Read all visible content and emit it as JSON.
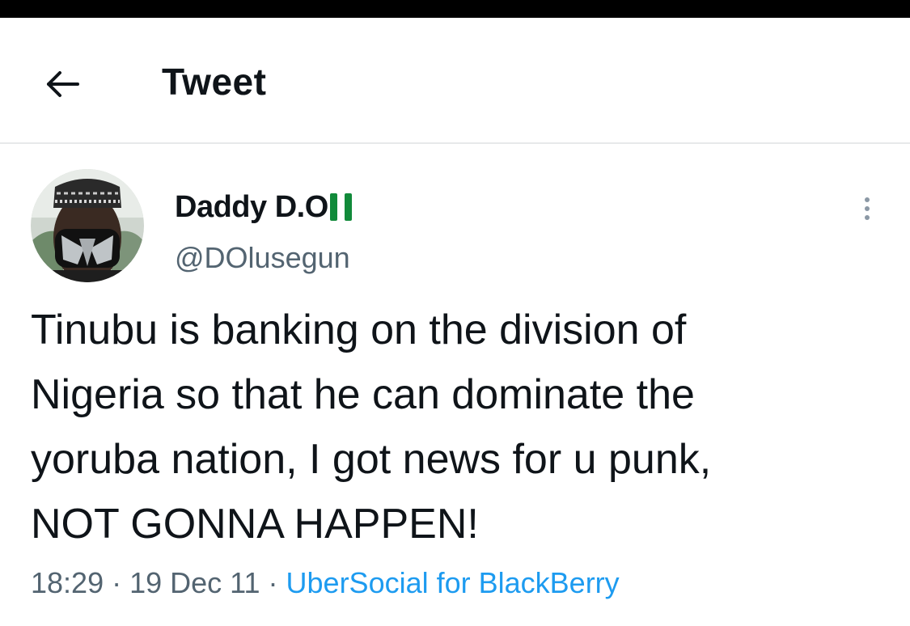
{
  "header": {
    "back_icon": "arrow-left-icon",
    "title": "Tweet"
  },
  "tweet": {
    "author": {
      "display_name": "Daddy D.O",
      "flag_emoji": "nigeria-flag-icon",
      "handle": "@DOlusegun",
      "avatar_icon": "avatar-photo"
    },
    "more_icon": "more-vertical-icon",
    "text": "Tinubu is banking on the division of\nNigeria so that he can dominate the\nyoruba nation, I got news for u punk,\nNOT GONNA HAPPEN!",
    "time": "18:29",
    "separator": " · ",
    "date": "19 Dec 11",
    "source": "UberSocial for BlackBerry"
  },
  "colors": {
    "accent": "#1d9bf0",
    "secondary_text": "#536471",
    "flag_green": "#118a3a"
  }
}
